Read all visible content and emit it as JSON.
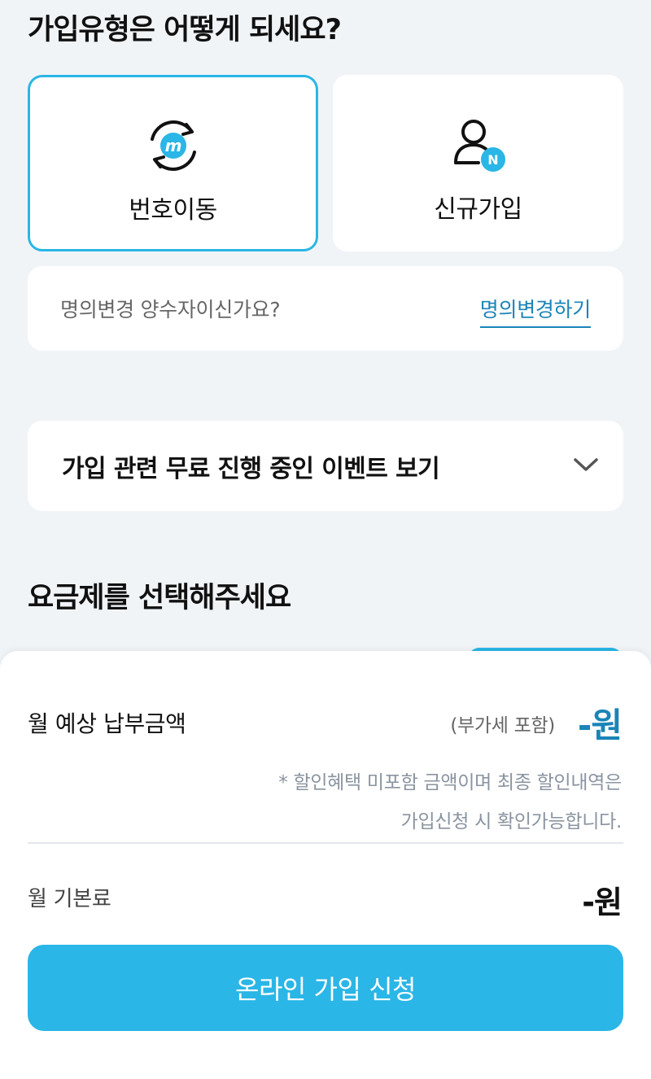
{
  "join_type": {
    "title": "가입유형은 어떻게 되세요?",
    "options": [
      {
        "label": "번호이동",
        "icon": "number-transfer-icon",
        "selected": true
      },
      {
        "label": "신규가입",
        "icon": "new-user-icon",
        "selected": false
      }
    ],
    "new_badge": "N",
    "transfer_badge": "m"
  },
  "name_change": {
    "question": "명의변경 양수자이신가요?",
    "link_label": "명의변경하기"
  },
  "event": {
    "label": "가입 관련 무료 진행 중인 이벤트 보기",
    "icon": "chevron-down-icon"
  },
  "plan": {
    "title": "요금제를 선택해주세요"
  },
  "summary": {
    "monthly_label": "월 예상 납부금액",
    "vat_label": "(부가세 포함)",
    "monthly_amount": "-원",
    "note_line1": "* 할인혜택 미포함 금액이며 최종 할인내역은",
    "note_line2": "가입신청 시 확인가능합니다.",
    "base_label": "월 기본료",
    "base_amount": "-원",
    "apply_label": "온라인 가입 신청"
  },
  "colors": {
    "accent": "#2ab6e6",
    "link": "#1b84b8",
    "background": "#f1f4f7"
  }
}
